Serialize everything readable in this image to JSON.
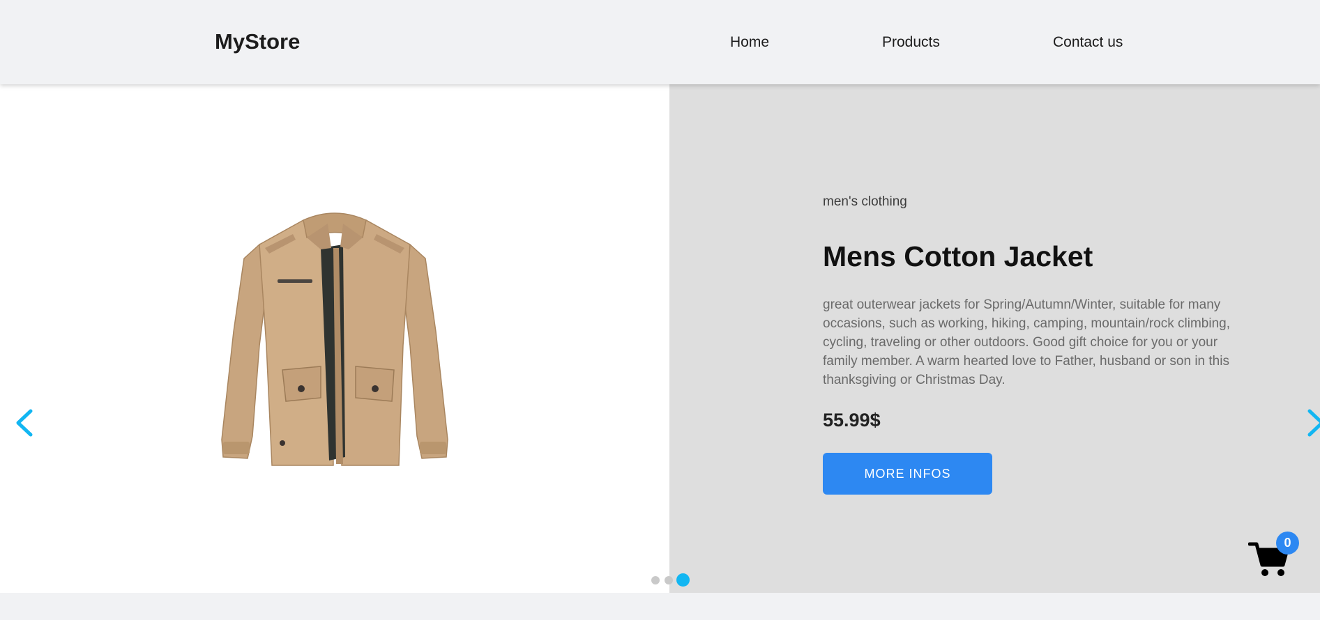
{
  "header": {
    "brand": "MyStore",
    "nav": {
      "home": "Home",
      "products": "Products",
      "contact": "Contact us"
    }
  },
  "slide": {
    "category": "men's clothing",
    "title": "Mens Cotton Jacket",
    "description": "great outerwear jackets for Spring/Autumn/Winter, suitable for many occasions, such as working, hiking, camping, mountain/rock climbing, cycling, traveling or other outdoors. Good gift choice for you or your family member. A warm hearted love to Father, husband or son in this thanksgiving or Christmas Day.",
    "price": "55.99$",
    "button_label": "MORE INFOS",
    "image_icon": "jacket-image"
  },
  "carousel": {
    "slide_count": 3,
    "active_index": 3,
    "prev_icon": "chevron-left-icon",
    "next_icon": "chevron-right-icon",
    "accent_color": "#12b6f2"
  },
  "cart": {
    "count": "0",
    "icon": "cart-icon",
    "badge_color": "#2d88f2"
  }
}
